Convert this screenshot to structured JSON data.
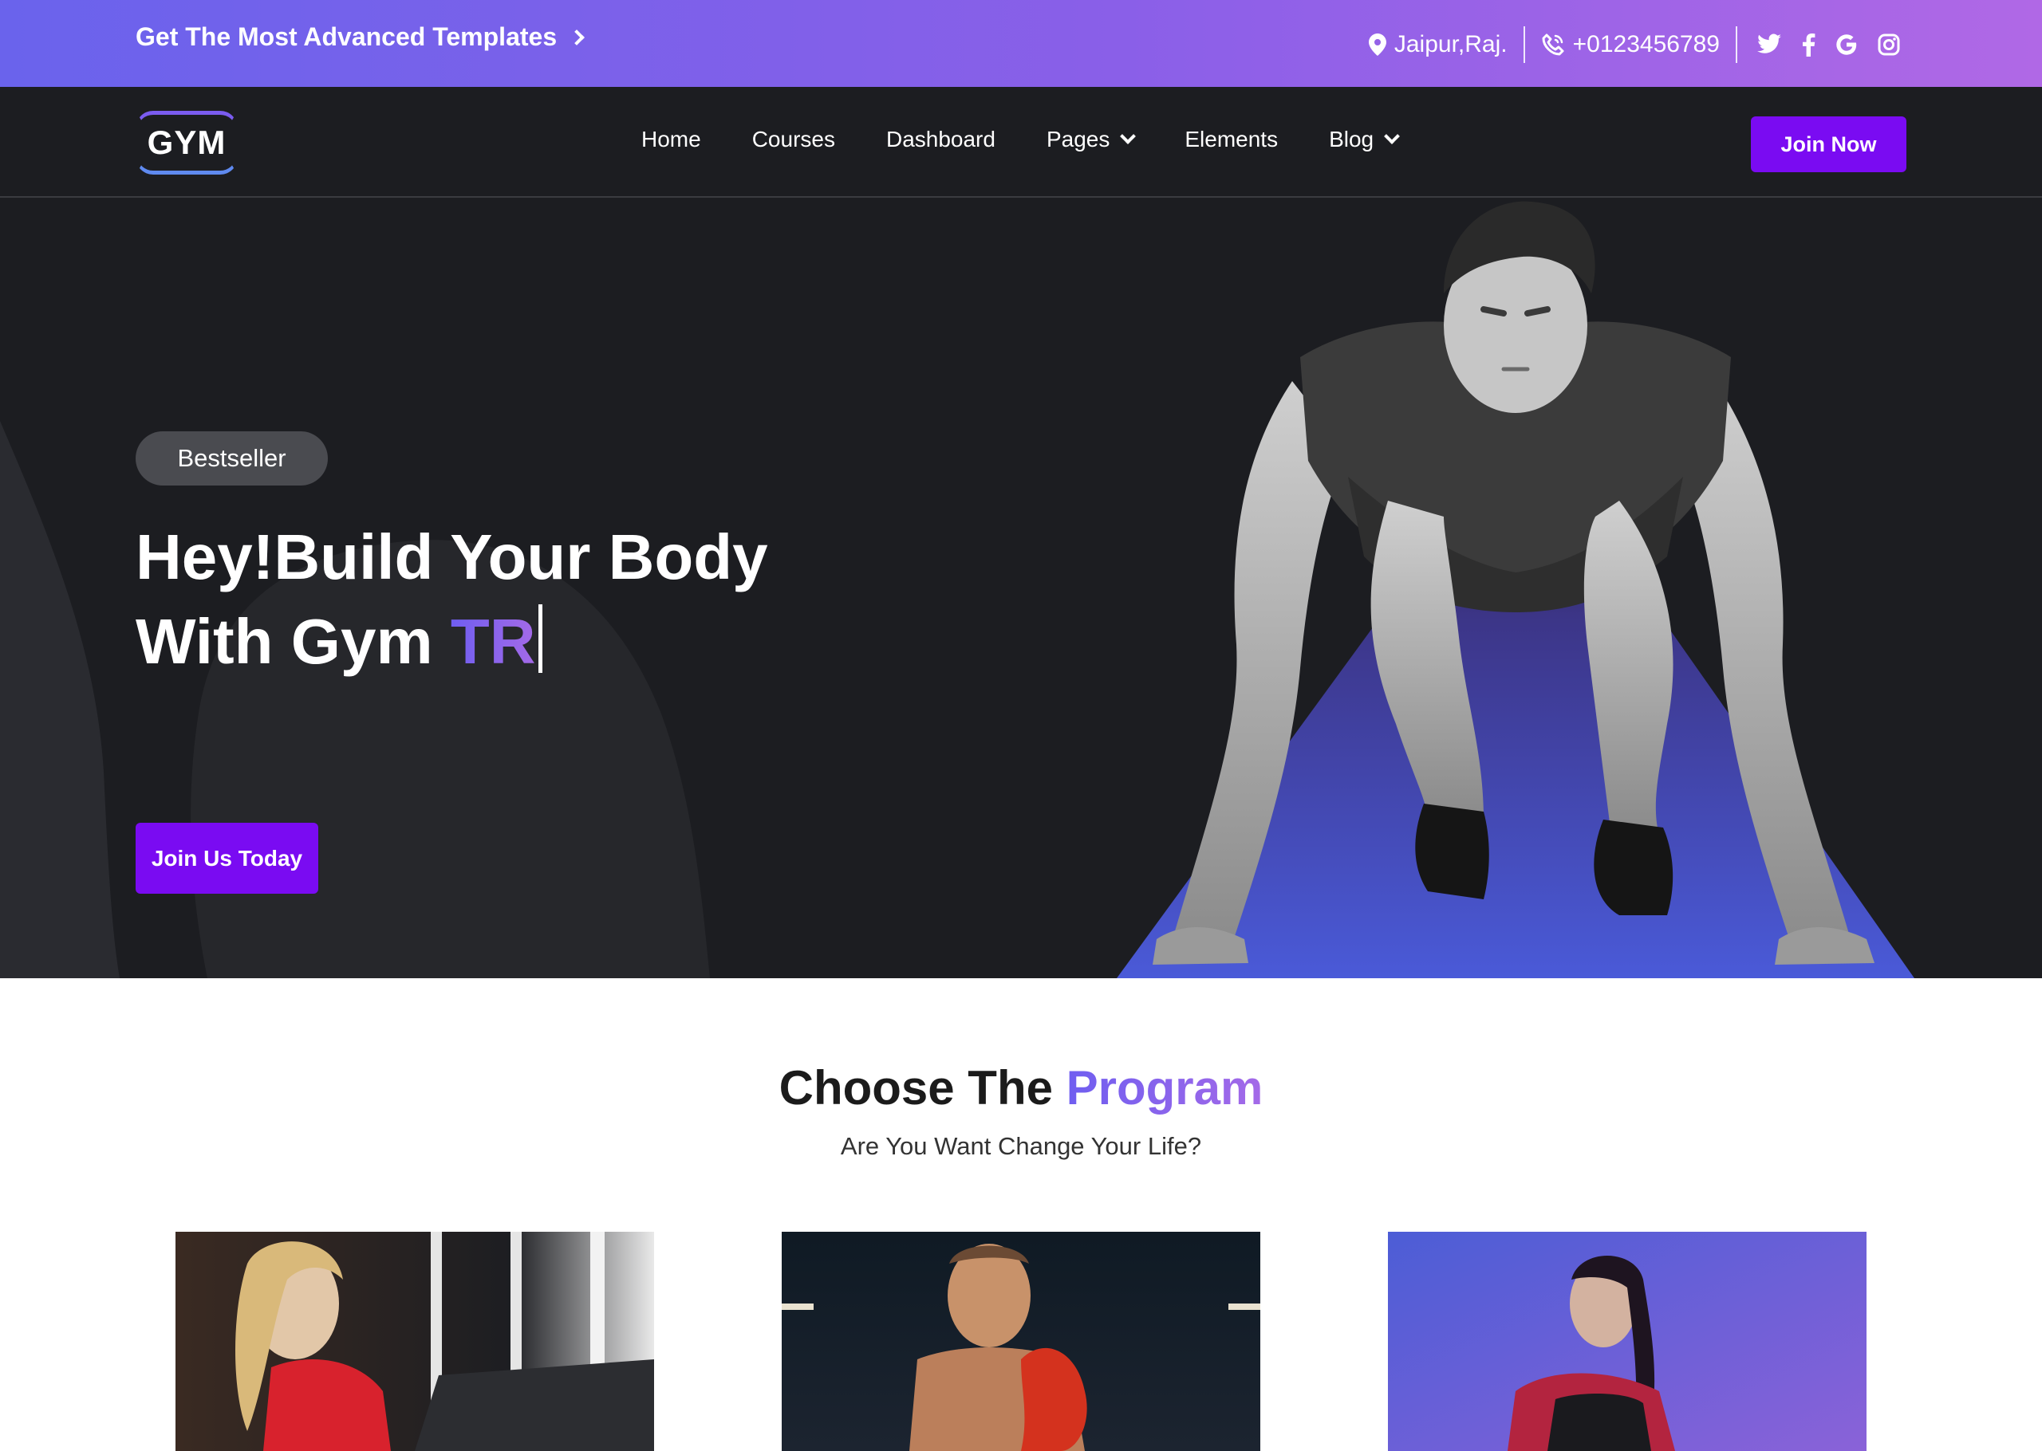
{
  "topbar": {
    "promo": "Get The Most Advanced Templates",
    "location": "Jaipur,Raj.",
    "phone": "+0123456789",
    "social_icons": [
      "twitter-icon",
      "facebook-icon",
      "google-icon",
      "instagram-icon"
    ]
  },
  "nav": {
    "logo": "GYM",
    "items": [
      {
        "label": "Home",
        "dropdown": false
      },
      {
        "label": "Courses",
        "dropdown": false
      },
      {
        "label": "Dashboard",
        "dropdown": false
      },
      {
        "label": "Pages",
        "dropdown": true
      },
      {
        "label": "Elements",
        "dropdown": false
      },
      {
        "label": "Blog",
        "dropdown": true
      }
    ],
    "cta": "Join Now"
  },
  "hero": {
    "badge": "Bestseller",
    "line1": "Hey!Build Your Body",
    "line2_prefix": "With Gym ",
    "line2_accent": "TR",
    "cta": "Join Us Today"
  },
  "programs": {
    "title_prefix": "Choose The ",
    "title_accent": "Program",
    "subtitle": "Are You Want Change Your Life?"
  },
  "colors": {
    "topbar_start": "#6a63ec",
    "topbar_end": "#b068e6",
    "dark_bg": "#1c1d21",
    "button": "#7a0bf2",
    "accent": "#7b5cf0"
  }
}
